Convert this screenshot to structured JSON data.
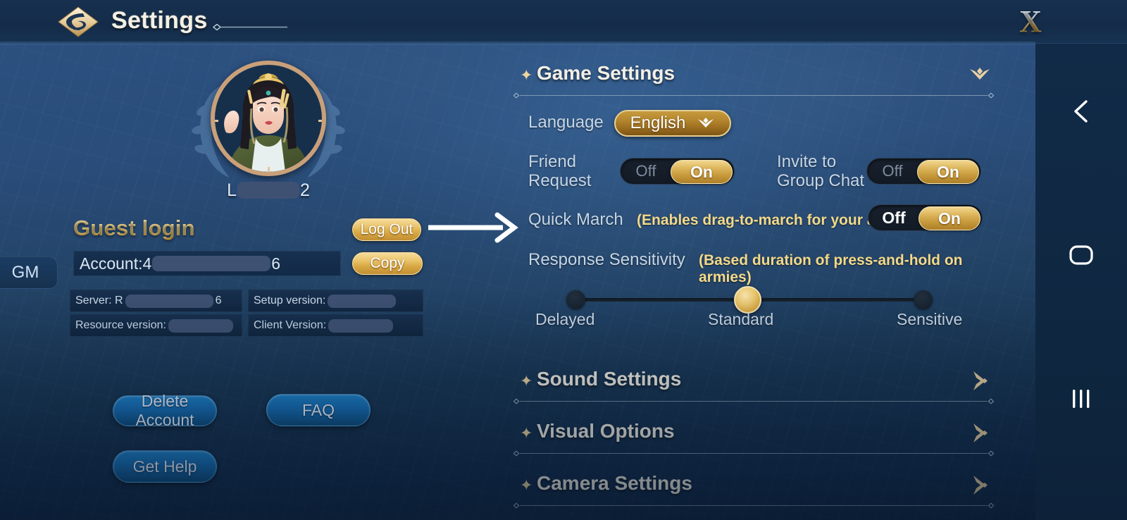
{
  "header": {
    "title": "Settings",
    "logo_icon": "diamond-emblem-icon",
    "close_label": "X"
  },
  "nav_rail": {
    "back_icon": "chevron-left-icon",
    "home_icon": "rounded-square-icon",
    "recents_icon": "three-bars-icon"
  },
  "account": {
    "avatar_icon": "player-portrait-icon",
    "name_prefix": "L",
    "name_suffix": "2",
    "login_type": "Guest login",
    "logout_label": "Log Out",
    "copy_label": "Copy",
    "gm_badge": "GM",
    "account_label": "Account:4",
    "account_suffix": "6",
    "versions": [
      {
        "label": "Server: R",
        "suffix": "6"
      },
      {
        "label": "Setup version:",
        "suffix": ""
      },
      {
        "label": "Resource version:",
        "suffix": ""
      },
      {
        "label": "Client Version:",
        "suffix": ""
      }
    ],
    "delete_account_label": "Delete Account",
    "faq_label": "FAQ",
    "get_help_label": "Get Help"
  },
  "game_settings": {
    "title": "Game Settings",
    "expanded_icon": "chevron-down-icon",
    "language": {
      "label": "Language",
      "value": "English",
      "dropdown_icon": "chevron-down-icon"
    },
    "friend_request": {
      "label_line1": "Friend",
      "label_line2": "Request",
      "off_label": "Off",
      "on_label": "On",
      "value": "On"
    },
    "invite_group_chat": {
      "label_line1": "Invite to",
      "label_line2": "Group Chat",
      "off_label": "Off",
      "on_label": "On",
      "value": "On"
    },
    "quick_march": {
      "label": "Quick March",
      "hint": "(Enables drag-to-march for your armies)",
      "off_label": "Off",
      "on_label": "On",
      "value": "On"
    },
    "response_sensitivity": {
      "label": "Response Sensitivity",
      "hint": "(Based duration of press-and-hold on armies)",
      "stops": [
        "Delayed",
        "Standard",
        "Sensitive"
      ],
      "value": "Standard",
      "value_index": 1
    }
  },
  "sections": [
    {
      "title": "Sound Settings",
      "expand_icon": "chevron-right-icon"
    },
    {
      "title": "Visual Options",
      "expand_icon": "chevron-right-icon"
    },
    {
      "title": "Camera Settings",
      "expand_icon": "chevron-right-icon"
    }
  ],
  "annotation": {
    "arrow_icon": "arrow-right-icon"
  },
  "colors": {
    "gold": "#e9c268",
    "gold_text": "#f3d98a",
    "blue_button": "#1772bb",
    "panel_bg": "#2c5180",
    "redaction": "#3f5173"
  }
}
